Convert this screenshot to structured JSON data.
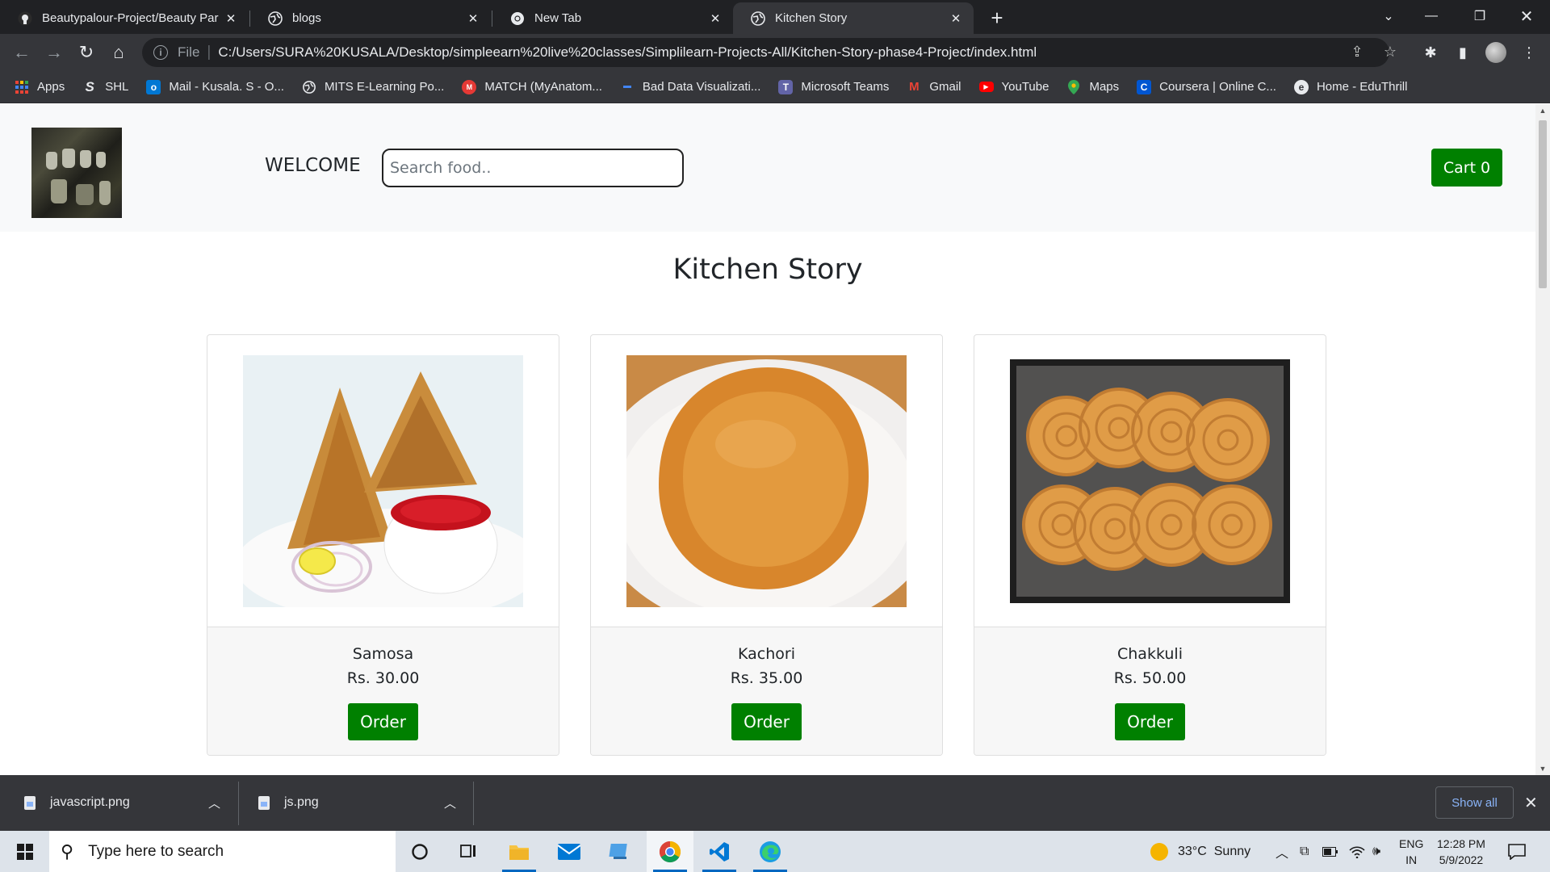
{
  "browser": {
    "tabs": [
      {
        "title": "Beautypalour-Project/Beauty Par",
        "icon": "github-icon",
        "active": false
      },
      {
        "title": "blogs",
        "icon": "globe-icon",
        "active": false
      },
      {
        "title": "New Tab",
        "icon": "chrome-icon",
        "active": false
      },
      {
        "title": "Kitchen Story",
        "icon": "globe-icon",
        "active": true
      }
    ],
    "address": {
      "scheme": "File",
      "url": "C:/Users/SURA%20KUSALA/Desktop/simpleearn%20live%20classes/Simplilearn-Projects-All/Kitchen-Story-phase4-Project/index.html"
    },
    "bookmarks": [
      {
        "label": "Apps",
        "icon": "apps-grid-icon",
        "color": "#ea4335"
      },
      {
        "label": "SHL",
        "icon": "shl-icon",
        "color": "#e8eaed"
      },
      {
        "label": "Mail - Kusala. S - O...",
        "icon": "outlook-icon",
        "color": "#0078d4"
      },
      {
        "label": "MITS E-Learning Po...",
        "icon": "globe-icon",
        "color": "#e8eaed"
      },
      {
        "label": "MATCH (MyAnatom...",
        "icon": "match-icon",
        "color": "#e53935"
      },
      {
        "label": "Bad Data Visualizati...",
        "icon": "dash-icon",
        "color": "#4285f4"
      },
      {
        "label": "Microsoft Teams",
        "icon": "teams-icon",
        "color": "#6264a7"
      },
      {
        "label": "Gmail",
        "icon": "gmail-icon",
        "color": "#ea4335"
      },
      {
        "label": "YouTube",
        "icon": "youtube-icon",
        "color": "#ff0000"
      },
      {
        "label": "Maps",
        "icon": "maps-icon",
        "color": "#34a853"
      },
      {
        "label": "Coursera | Online C...",
        "icon": "coursera-icon",
        "color": "#0056d2"
      },
      {
        "label": "Home - EduThrill",
        "icon": "eduthrill-icon",
        "color": "#e8eaed"
      }
    ]
  },
  "site": {
    "welcome": "WELCOME",
    "search_placeholder": "Search food..",
    "cart_label": "Cart 0",
    "title": "Kitchen Story",
    "products": [
      {
        "name": "Samosa",
        "price": "Rs. 30.00",
        "order": "Order"
      },
      {
        "name": "Kachori",
        "price": "Rs. 35.00",
        "order": "Order"
      },
      {
        "name": "Chakkuli",
        "price": "Rs. 50.00",
        "order": "Order"
      }
    ],
    "accent_color": "#008000"
  },
  "downloads": {
    "items": [
      {
        "name": "javascript.png"
      },
      {
        "name": "js.png"
      }
    ],
    "show_all": "Show all"
  },
  "taskbar": {
    "search_placeholder": "Type here to search",
    "weather_temp": "33°C",
    "weather_desc": "Sunny",
    "lang_top": "ENG",
    "lang_bottom": "IN",
    "time": "12:28 PM",
    "date": "5/9/2022"
  }
}
